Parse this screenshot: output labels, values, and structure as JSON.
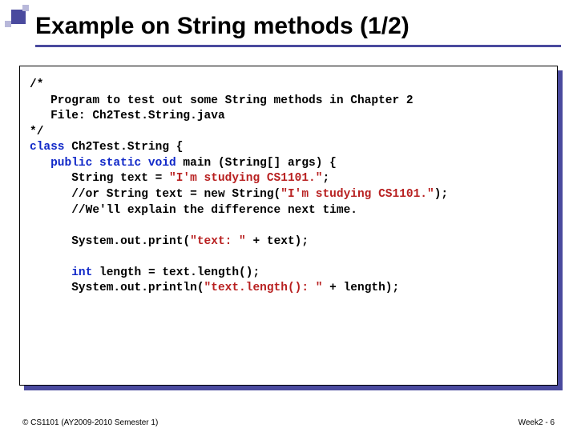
{
  "title": "Example on String methods (1/2)",
  "code": {
    "l1": "/*",
    "l2": "   Program to test out some String methods in Chapter 2",
    "l3": "   File: Ch2Test.String.java",
    "l4": "*/",
    "l5a": "class",
    "l5b": " Ch2Test.String {",
    "l6a": "   public static void",
    "l6b": " main (String[] args) {",
    "l7a": "      String text = ",
    "l7b": "\"I'm studying CS1101.\"",
    "l7c": ";",
    "l8a": "      //or String text = new String(",
    "l8b": "\"I'm studying CS1101.\"",
    "l8c": ");",
    "l9": "      //We'll explain the difference next time.",
    "l10a": "      System.out.print(",
    "l10b": "\"text: \"",
    "l10c": " + text);",
    "l11a": "      int",
    "l11b": " length = text.length();",
    "l12a": "      System.out.println(",
    "l12b": "\"text.length(): \"",
    "l12c": " + length);"
  },
  "footer": {
    "left": "© CS1101 (AY2009-2010 Semester 1)",
    "right": "Week2 - 6"
  }
}
